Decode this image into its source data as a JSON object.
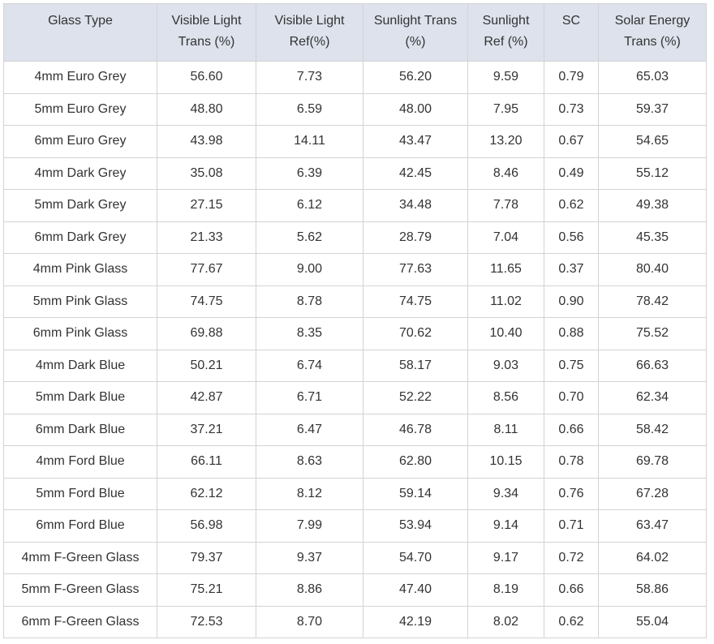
{
  "table": {
    "headers": [
      "Glass Type",
      "Visible Light Trans (%)",
      "Visible Light Ref(%)",
      "Sunlight Trans (%)",
      "Sunlight Ref (%)",
      "SC",
      "Solar Energy Trans (%)"
    ],
    "rows": [
      [
        "4mm Euro Grey",
        "56.60",
        "7.73",
        "56.20",
        "9.59",
        "0.79",
        "65.03"
      ],
      [
        "5mm Euro Grey",
        "48.80",
        "6.59",
        "48.00",
        "7.95",
        "0.73",
        "59.37"
      ],
      [
        "6mm Euro Grey",
        "43.98",
        "14.11",
        "43.47",
        "13.20",
        "0.67",
        "54.65"
      ],
      [
        "4mm Dark Grey",
        "35.08",
        "6.39",
        "42.45",
        "8.46",
        "0.49",
        "55.12"
      ],
      [
        "5mm Dark Grey",
        "27.15",
        "6.12",
        "34.48",
        "7.78",
        "0.62",
        "49.38"
      ],
      [
        "6mm Dark Grey",
        "21.33",
        "5.62",
        "28.79",
        "7.04",
        "0.56",
        "45.35"
      ],
      [
        "4mm Pink Glass",
        "77.67",
        "9.00",
        "77.63",
        "11.65",
        "0.37",
        "80.40"
      ],
      [
        "5mm Pink Glass",
        "74.75",
        "8.78",
        "74.75",
        "11.02",
        "0.90",
        "78.42"
      ],
      [
        "6mm Pink Glass",
        "69.88",
        "8.35",
        "70.62",
        "10.40",
        "0.88",
        "75.52"
      ],
      [
        "4mm Dark Blue",
        "50.21",
        "6.74",
        "58.17",
        "9.03",
        "0.75",
        "66.63"
      ],
      [
        "5mm Dark Blue",
        "42.87",
        "6.71",
        "52.22",
        "8.56",
        "0.70",
        "62.34"
      ],
      [
        "6mm Dark Blue",
        "37.21",
        "6.47",
        "46.78",
        "8.11",
        "0.66",
        "58.42"
      ],
      [
        "4mm Ford Blue",
        "66.11",
        "8.63",
        "62.80",
        "10.15",
        "0.78",
        "69.78"
      ],
      [
        "5mm Ford Blue",
        "62.12",
        "8.12",
        "59.14",
        "9.34",
        "0.76",
        "67.28"
      ],
      [
        "6mm Ford Blue",
        "56.98",
        "7.99",
        "53.94",
        "9.14",
        "0.71",
        "63.47"
      ],
      [
        "4mm F-Green Glass",
        "79.37",
        "9.37",
        "54.70",
        "9.17",
        "0.72",
        "64.02"
      ],
      [
        "5mm F-Green Glass",
        "75.21",
        "8.86",
        "47.40",
        "8.19",
        "0.66",
        "58.86"
      ],
      [
        "6mm F-Green Glass",
        "72.53",
        "8.70",
        "42.19",
        "8.02",
        "0.62",
        "55.04"
      ]
    ]
  }
}
